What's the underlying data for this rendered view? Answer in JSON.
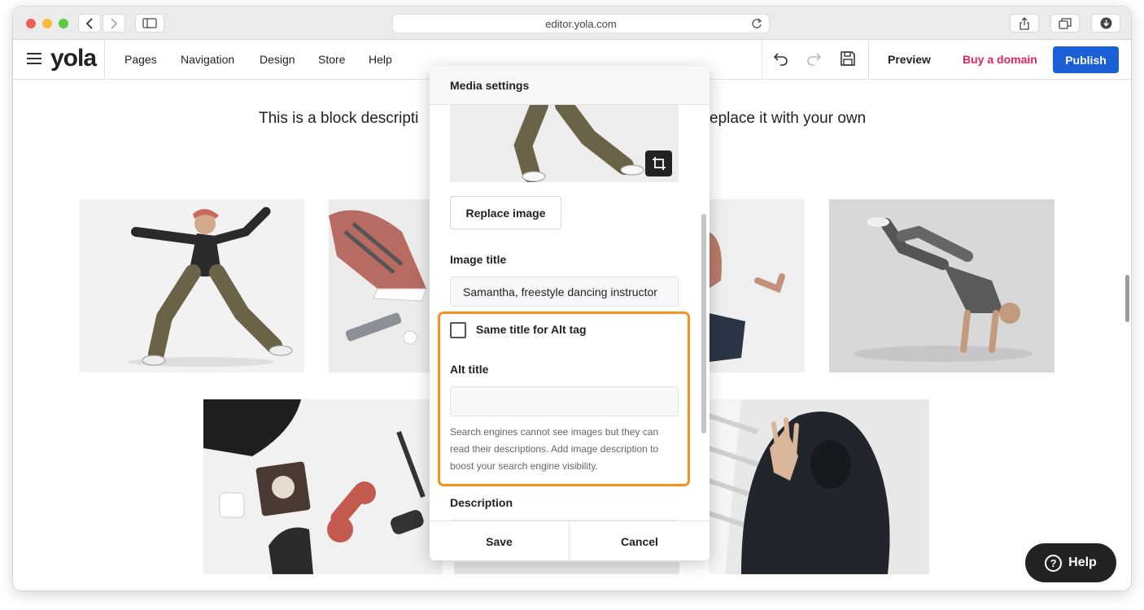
{
  "browser": {
    "url": "editor.yola.com",
    "colors": {
      "close": "#ee5f57",
      "minimize": "#f6bd3b",
      "maximize": "#5fc93f"
    }
  },
  "topbar": {
    "logo": "yola",
    "nav": [
      "Pages",
      "Navigation",
      "Design",
      "Store",
      "Help"
    ],
    "preview_label": "Preview",
    "buy_domain_label": "Buy a domain",
    "publish_label": "Publish",
    "colors": {
      "publish": "#1a5fd6",
      "buy_domain": "#e0245e"
    }
  },
  "page": {
    "block_description_left": "This is a block descripti",
    "block_description_right": "eplace it with your own"
  },
  "modal": {
    "title": "Media settings",
    "replace_image_label": "Replace image",
    "image_title_label": "Image title",
    "image_title_value": "Samantha, freestyle dancing instructor",
    "same_title_checkbox_label": "Same title for Alt tag",
    "same_title_checked": false,
    "alt_title_label": "Alt title",
    "alt_title_value": "",
    "hint": "Search engines cannot see images but they can read their descriptions. Add image description to boost your search engine visibility.",
    "description_label": "Description",
    "save_label": "Save",
    "cancel_label": "Cancel",
    "highlight_color": "#f5921e"
  },
  "help_button": {
    "label": "Help"
  }
}
